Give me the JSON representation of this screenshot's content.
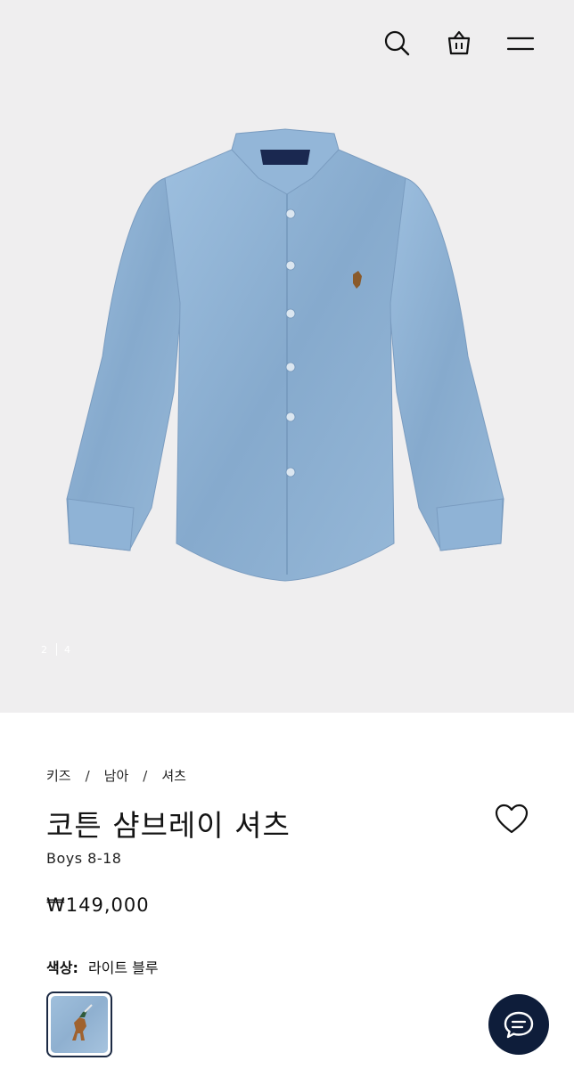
{
  "header": {
    "icons": [
      "search-icon",
      "shopping-bag-icon",
      "menu-icon"
    ]
  },
  "gallery": {
    "current": "2",
    "total": "4"
  },
  "breadcrumb": [
    "키즈",
    "남아",
    "셔츠"
  ],
  "breadcrumb_separator": "/",
  "product": {
    "title": "코튼 샴브레이 셔츠",
    "subtitle": "Boys 8-18",
    "price": "₩149,000",
    "color_label": "색상:",
    "color_value": "라이트 블루"
  },
  "colors": {
    "hero_bg": "#efeeef",
    "shirt": "#8fb3d6",
    "swatch_border": "#1c2a44",
    "chat_bg": "#0e1d3a"
  },
  "chat_icon": "chat-bubble-icon",
  "wishlist_icon": "heart-icon"
}
